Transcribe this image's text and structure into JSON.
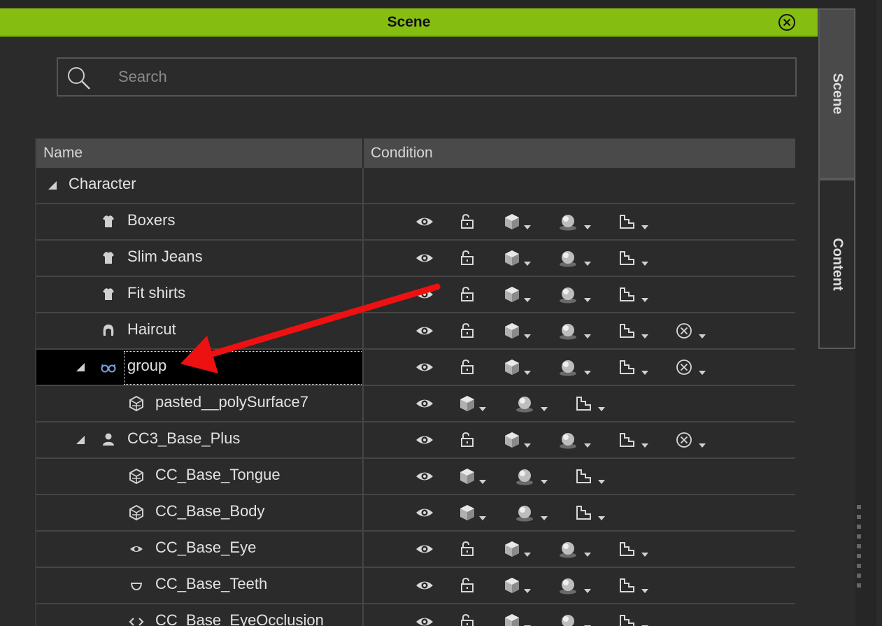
{
  "window": {
    "title": "Scene",
    "close_icon": "close-circle-icon",
    "accent_color": "#86bd11"
  },
  "search": {
    "placeholder": "Search",
    "value": ""
  },
  "table": {
    "columns": [
      "Name",
      "Condition"
    ],
    "rows": [
      {
        "label": "Character",
        "icon": "",
        "level": 0,
        "expanded": true,
        "conditions": []
      },
      {
        "label": "Boxers",
        "icon": "shirt-icon",
        "level": 2,
        "conditions": [
          "eye",
          "lock",
          "cube",
          "sphere",
          "mesh"
        ]
      },
      {
        "label": "Slim Jeans",
        "icon": "shirt-icon",
        "level": 2,
        "conditions": [
          "eye",
          "lock",
          "cube",
          "sphere",
          "mesh"
        ]
      },
      {
        "label": "Fit shirts",
        "icon": "shirt-icon",
        "level": 2,
        "conditions": [
          "eye",
          "lock",
          "cube",
          "sphere",
          "mesh"
        ]
      },
      {
        "label": "Haircut",
        "icon": "hair-icon",
        "level": 2,
        "conditions": [
          "eye",
          "lock",
          "cube",
          "sphere",
          "mesh",
          "xcircle"
        ]
      },
      {
        "label": "group",
        "icon": "glasses-icon",
        "level": 1,
        "expanded": true,
        "selected": true,
        "editing": true,
        "conditions": [
          "eye",
          "lock",
          "cube",
          "sphere",
          "mesh",
          "xcircle"
        ]
      },
      {
        "label": "pasted__polySurface7",
        "icon": "mesh-icon",
        "level": 3,
        "conditions": [
          "eye",
          "cube",
          "sphere",
          "mesh"
        ]
      },
      {
        "label": "CC3_Base_Plus",
        "icon": "person-icon",
        "level": 1,
        "expanded": true,
        "conditions": [
          "eye",
          "lock",
          "cube",
          "sphere",
          "mesh",
          "xcircle"
        ]
      },
      {
        "label": "CC_Base_Tongue",
        "icon": "mesh-icon",
        "level": 3,
        "conditions": [
          "eye",
          "cube",
          "sphere",
          "mesh"
        ]
      },
      {
        "label": "CC_Base_Body",
        "icon": "mesh-icon",
        "level": 3,
        "conditions": [
          "eye",
          "cube",
          "sphere",
          "mesh"
        ]
      },
      {
        "label": "CC_Base_Eye",
        "icon": "eye-icon",
        "level": 3,
        "conditions": [
          "eye",
          "lock",
          "cube",
          "sphere",
          "mesh"
        ]
      },
      {
        "label": "CC_Base_Teeth",
        "icon": "teeth-icon",
        "level": 3,
        "conditions": [
          "eye",
          "lock",
          "cube",
          "sphere",
          "mesh"
        ]
      },
      {
        "label": "CC_Base_EyeOcclusion",
        "icon": "occlusion-icon",
        "level": 3,
        "conditions": [
          "eye",
          "lock",
          "cube",
          "sphere",
          "mesh"
        ]
      }
    ]
  },
  "side_tabs": [
    {
      "label": "Scene",
      "active": true
    },
    {
      "label": "Content",
      "active": false
    }
  ],
  "annotation": {
    "type": "arrow",
    "color": "#ee1111"
  }
}
